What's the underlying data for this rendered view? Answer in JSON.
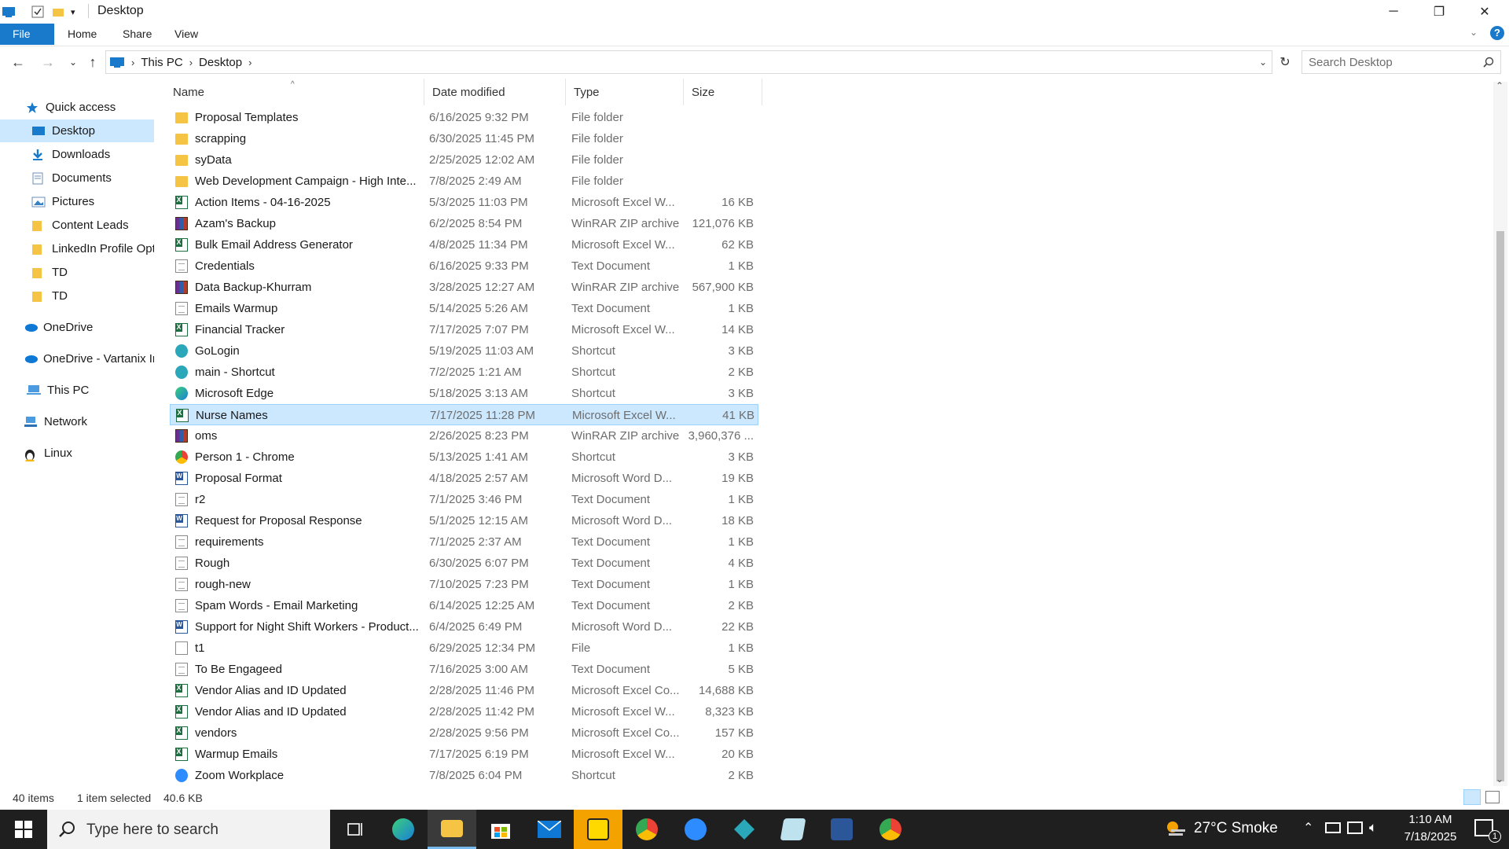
{
  "window": {
    "title": "Desktop"
  },
  "ribbon": {
    "tabs": [
      "File",
      "Home",
      "Share",
      "View"
    ]
  },
  "address": {
    "crumbs": [
      "This PC",
      "Desktop"
    ],
    "search_placeholder": "Search Desktop"
  },
  "nav": {
    "quick_access": "Quick access",
    "items": [
      {
        "label": "Desktop",
        "pinned": true
      },
      {
        "label": "Downloads",
        "pinned": true
      },
      {
        "label": "Documents",
        "pinned": true
      },
      {
        "label": "Pictures",
        "pinned": true
      },
      {
        "label": "Content Leads",
        "pinned": false
      },
      {
        "label": "LinkedIn Profile Opt",
        "pinned": false
      },
      {
        "label": "TD",
        "pinned": false
      },
      {
        "label": "TD",
        "pinned": false
      }
    ],
    "onedrive": "OneDrive",
    "onedrive_business": "OneDrive - Vartanix In",
    "this_pc": "This PC",
    "network": "Network",
    "linux": "Linux"
  },
  "columns": {
    "name": "Name",
    "date": "Date modified",
    "type": "Type",
    "size": "Size"
  },
  "files": [
    {
      "name": "Proposal Templates",
      "date": "6/16/2025 9:32 PM",
      "type": "File folder",
      "size": "",
      "icon": "folder"
    },
    {
      "name": "scrapping",
      "date": "6/30/2025 11:45 PM",
      "type": "File folder",
      "size": "",
      "icon": "folder"
    },
    {
      "name": "syData",
      "date": "2/25/2025 12:02 AM",
      "type": "File folder",
      "size": "",
      "icon": "folder"
    },
    {
      "name": "Web Development Campaign - High Inte...",
      "date": "7/8/2025 2:49 AM",
      "type": "File folder",
      "size": "",
      "icon": "folder"
    },
    {
      "name": "Action Items - 04-16-2025",
      "date": "5/3/2025 11:03 PM",
      "type": "Microsoft Excel W...",
      "size": "16 KB",
      "icon": "excel"
    },
    {
      "name": "Azam's Backup",
      "date": "6/2/2025 8:54 PM",
      "type": "WinRAR ZIP archive",
      "size": "121,076 KB",
      "icon": "zip"
    },
    {
      "name": "Bulk Email Address Generator",
      "date": "4/8/2025 11:34 PM",
      "type": "Microsoft Excel W...",
      "size": "62 KB",
      "icon": "excel"
    },
    {
      "name": "Credentials",
      "date": "6/16/2025 9:33 PM",
      "type": "Text Document",
      "size": "1 KB",
      "icon": "text"
    },
    {
      "name": "Data Backup-Khurram",
      "date": "3/28/2025 12:27 AM",
      "type": "WinRAR ZIP archive",
      "size": "567,900 KB",
      "icon": "zip"
    },
    {
      "name": "Emails Warmup",
      "date": "5/14/2025 5:26 AM",
      "type": "Text Document",
      "size": "1 KB",
      "icon": "text"
    },
    {
      "name": "Financial Tracker",
      "date": "7/17/2025 7:07 PM",
      "type": "Microsoft Excel W...",
      "size": "14 KB",
      "icon": "excel"
    },
    {
      "name": "GoLogin",
      "date": "5/19/2025 11:03 AM",
      "type": "Shortcut",
      "size": "3 KB",
      "icon": "shortcut"
    },
    {
      "name": "main - Shortcut",
      "date": "7/2/2025 1:21 AM",
      "type": "Shortcut",
      "size": "2 KB",
      "icon": "shortcut"
    },
    {
      "name": "Microsoft Edge",
      "date": "5/18/2025 3:13 AM",
      "type": "Shortcut",
      "size": "3 KB",
      "icon": "edge"
    },
    {
      "name": "Nurse Names",
      "date": "7/17/2025 11:28 PM",
      "type": "Microsoft Excel W...",
      "size": "41 KB",
      "icon": "excel",
      "selected": true
    },
    {
      "name": "oms",
      "date": "2/26/2025 8:23 PM",
      "type": "WinRAR ZIP archive",
      "size": "3,960,376 ...",
      "icon": "zip"
    },
    {
      "name": "Person 1 - Chrome",
      "date": "5/13/2025 1:41 AM",
      "type": "Shortcut",
      "size": "3 KB",
      "icon": "chrome"
    },
    {
      "name": "Proposal Format",
      "date": "4/18/2025 2:57 AM",
      "type": "Microsoft Word D...",
      "size": "19 KB",
      "icon": "word"
    },
    {
      "name": "r2",
      "date": "7/1/2025 3:46 PM",
      "type": "Text Document",
      "size": "1 KB",
      "icon": "text"
    },
    {
      "name": "Request for Proposal Response",
      "date": "5/1/2025 12:15 AM",
      "type": "Microsoft Word D...",
      "size": "18 KB",
      "icon": "word"
    },
    {
      "name": "requirements",
      "date": "7/1/2025 2:37 AM",
      "type": "Text Document",
      "size": "1 KB",
      "icon": "text"
    },
    {
      "name": "Rough",
      "date": "6/30/2025 6:07 PM",
      "type": "Text Document",
      "size": "4 KB",
      "icon": "text"
    },
    {
      "name": "rough-new",
      "date": "7/10/2025 7:23 PM",
      "type": "Text Document",
      "size": "1 KB",
      "icon": "text"
    },
    {
      "name": "Spam Words - Email Marketing",
      "date": "6/14/2025 12:25 AM",
      "type": "Text Document",
      "size": "2 KB",
      "icon": "text"
    },
    {
      "name": "Support for Night Shift Workers - Product...",
      "date": "6/4/2025 6:49 PM",
      "type": "Microsoft Word D...",
      "size": "22 KB",
      "icon": "word"
    },
    {
      "name": "t1",
      "date": "6/29/2025 12:34 PM",
      "type": "File",
      "size": "1 KB",
      "icon": "file"
    },
    {
      "name": "To Be Engageed",
      "date": "7/16/2025 3:00 AM",
      "type": "Text Document",
      "size": "5 KB",
      "icon": "text"
    },
    {
      "name": "Vendor Alias and ID Updated",
      "date": "2/28/2025 11:46 PM",
      "type": "Microsoft Excel Co...",
      "size": "14,688 KB",
      "icon": "excel"
    },
    {
      "name": "Vendor Alias and ID Updated",
      "date": "2/28/2025 11:42 PM",
      "type": "Microsoft Excel W...",
      "size": "8,323 KB",
      "icon": "excel"
    },
    {
      "name": "vendors",
      "date": "2/28/2025 9:56 PM",
      "type": "Microsoft Excel Co...",
      "size": "157 KB",
      "icon": "excel"
    },
    {
      "name": "Warmup Emails",
      "date": "7/17/2025 6:19 PM",
      "type": "Microsoft Excel W...",
      "size": "20 KB",
      "icon": "excel"
    },
    {
      "name": "Zoom Workplace",
      "date": "7/8/2025 6:04 PM",
      "type": "Shortcut",
      "size": "2 KB",
      "icon": "zoom"
    }
  ],
  "status": {
    "count": "40 items",
    "selected": "1 item selected",
    "selected_size": "40.6 KB"
  },
  "taskbar": {
    "search_placeholder": "Type here to search",
    "weather": "27°C Smoke",
    "time": "1:10 AM",
    "date": "7/18/2025",
    "notification_count": "1"
  },
  "colors": {
    "accent": "#1979ca",
    "selection": "#cce8ff",
    "folder": "#f6c445"
  }
}
